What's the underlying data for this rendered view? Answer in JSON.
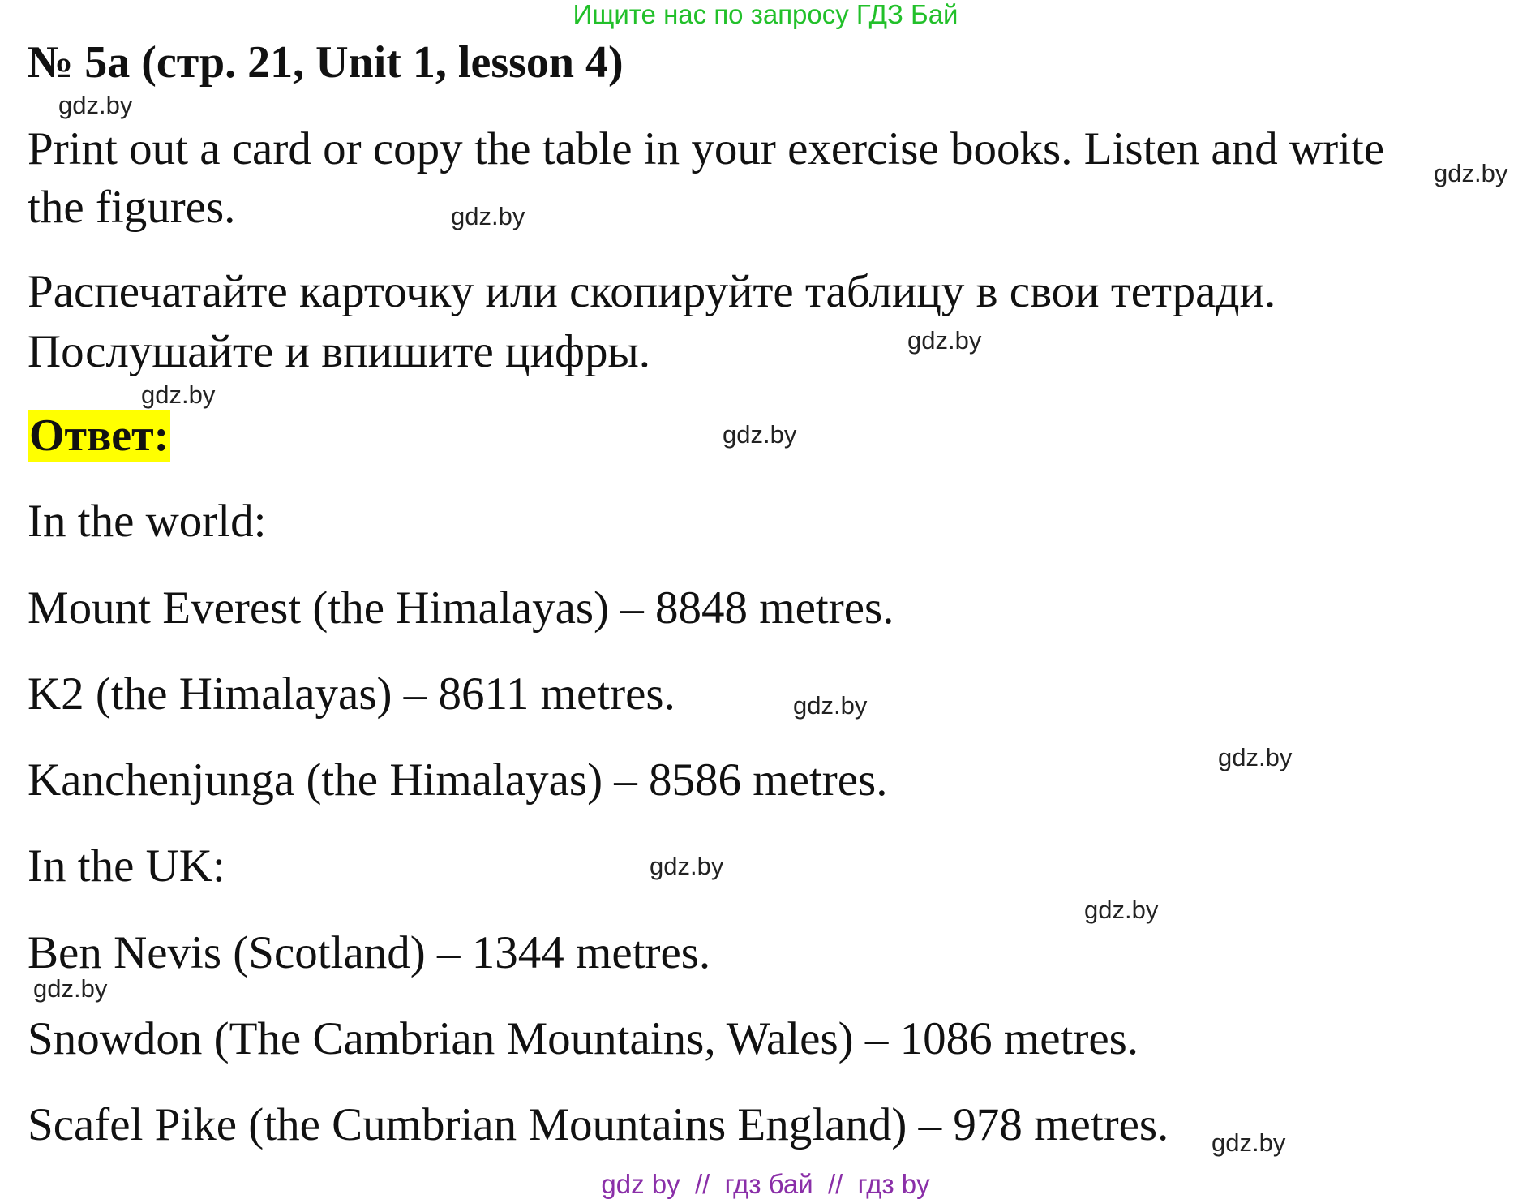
{
  "banner": "Ищите нас по запросу ГДЗ Бай",
  "title": "№ 5a (стр. 21, Unit 1, lesson 4)",
  "task_en": [
    "Print out a card or copy the table in your exercise books. Listen and write",
    "the figures."
  ],
  "task_ru": [
    "Распечатайте карточку или скопируйте таблицу в свои тетради.",
    "Послушайте и впишите цифры."
  ],
  "answer_label": "Ответ:",
  "answer_lines": [
    "In the world:",
    "Mount Everest (the Himalayas) – 8848 metres.",
    "K2 (the Himalayas) – 8611 metres.",
    "Kanchenjunga (the Himalayas) – 8586 metres.",
    "In the UK:",
    "Ben Nevis (Scotland) – 1344 metres.",
    "Snowdon (The Cambrian Mountains, Wales) – 1086 metres.",
    "Scafel Pike (the Cumbrian Mountains England) – 978 metres."
  ],
  "watermark": "gdz.by",
  "footer": "gdz by  //  гдз бай  //  гдз by",
  "colors": {
    "banner": "#22c02a",
    "highlight": "#ffff00",
    "footer": "#8a2fa8"
  }
}
